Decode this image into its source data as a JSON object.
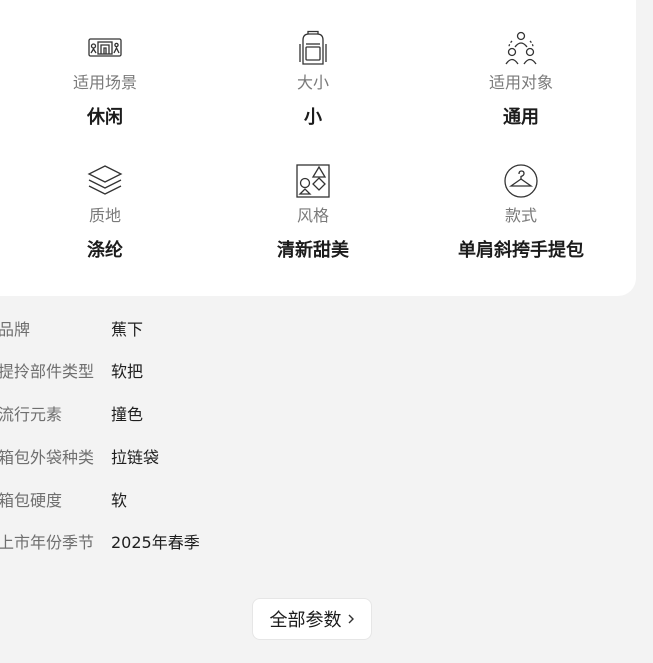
{
  "attributes": [
    {
      "icon": "scene-icon",
      "label": "适用场景",
      "value": "休闲"
    },
    {
      "icon": "backpack-icon",
      "label": "大小",
      "value": "小"
    },
    {
      "icon": "people-icon",
      "label": "适用对象",
      "value": "通用"
    },
    {
      "icon": "layers-icon",
      "label": "质地",
      "value": "涤纶"
    },
    {
      "icon": "shapes-icon",
      "label": "风格",
      "value": "清新甜美"
    },
    {
      "icon": "hanger-icon",
      "label": "款式",
      "value": "单肩斜挎手提包"
    }
  ],
  "params": [
    {
      "key": "品牌",
      "value": "蕉下"
    },
    {
      "key": "提拎部件类型",
      "value": "软把"
    },
    {
      "key": "流行元素",
      "value": "撞色"
    },
    {
      "key": "箱包外袋种类",
      "value": "拉链袋"
    },
    {
      "key": "箱包硬度",
      "value": "软"
    },
    {
      "key": "上市年份季节",
      "value": "2025年春季"
    }
  ],
  "all_params_button": {
    "label": "全部参数"
  }
}
